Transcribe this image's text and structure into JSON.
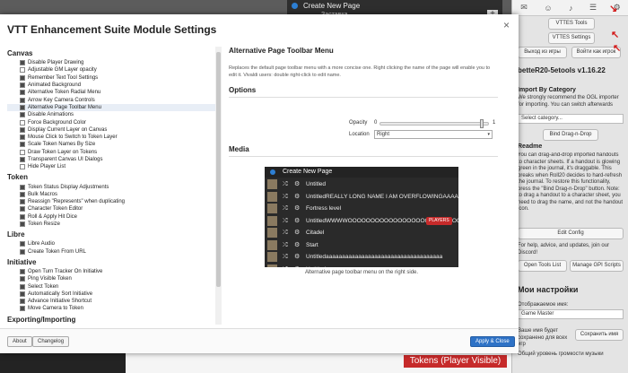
{
  "app": {
    "page_toolbar": {
      "header": "Create New Page",
      "sub": "Заставка",
      "add": "+"
    },
    "sidebar": {
      "tool_buttons": [
        "VTTES Tools",
        "VTTES Settings"
      ],
      "exit_label": "Выход из игры",
      "join_label": "Войти как игрок",
      "version": "betteR20-5etools v1.16.22",
      "import_title": "Import By Category",
      "import_desc": "We strongly recommend the OGL importer for importing. You can switch afterwards",
      "select_placeholder": "Select category...",
      "bind_label": "Bind Drag-n-Drop",
      "readme_title": "Readme",
      "readme_text": "You can drag-and-drop imported handouts to character sheets. If a handout is glowing green in the journal, it's draggable. This breaks when Roll20 decides to hard-refresh the journal. To restore this functionality, press the \"Bind Drag-n-Drop\" button. Note: to drag a handout to a character sheet, you need to drag the name, and not the handout icon.",
      "edit_config": "Edit Config",
      "help_text": "For help, advice, and updates, join our Discord!",
      "open_tools": "Open Tools List",
      "gpi_scripts": "Manage GPI Scripts",
      "my_settings": "Мои настройки",
      "display_name_label": "Отображаемое имя:",
      "display_name_value": "Game Master",
      "remember_note": "Ваше имя будет сохранено для всех игр",
      "save_name": "Сохранить имя",
      "volume_label": "Общий уровень громкости музыки"
    },
    "tokens_badge": "Tokens (Player Visible)"
  },
  "modal": {
    "title": "VTT Enhancement Suite Module Settings",
    "close": "×",
    "categories": [
      {
        "name": "Canvas",
        "items": [
          {
            "label": "Disable Player Drawing",
            "checked": true
          },
          {
            "label": "Adjustable GM Layer opacity",
            "checked": false
          },
          {
            "label": "Remember Text Tool Settings",
            "checked": true
          },
          {
            "label": "Animated Background",
            "checked": true
          },
          {
            "label": "Alternative Token Radial Menu",
            "checked": true
          },
          {
            "label": "Arrow Key Camera Controls",
            "checked": true
          },
          {
            "label": "Alternative Page Toolbar Menu",
            "checked": true
          },
          {
            "label": "Disable Animations",
            "checked": true
          },
          {
            "label": "Force Background Color",
            "checked": false
          },
          {
            "label": "Display Current Layer on Canvas",
            "checked": true
          },
          {
            "label": "Mouse Click to Switch to Token Layer",
            "checked": true
          },
          {
            "label": "Scale Token Names By Size",
            "checked": true
          },
          {
            "label": "Draw Token Layer on Tokens",
            "checked": false
          },
          {
            "label": "Transparent Canvas UI Dialogs",
            "checked": true
          },
          {
            "label": "Hide Player List",
            "checked": false
          }
        ]
      },
      {
        "name": "Token",
        "items": [
          {
            "label": "Token Status Display Adjustments",
            "checked": true
          },
          {
            "label": "Bulk Macros",
            "checked": true
          },
          {
            "label": "Reassign \"Represents\" when duplicating",
            "checked": true
          },
          {
            "label": "Character Token Editor",
            "checked": true
          },
          {
            "label": "Roll & Apply Hit Dice",
            "checked": true
          },
          {
            "label": "Token Resize",
            "checked": true
          }
        ]
      },
      {
        "name": "Libre",
        "items": [
          {
            "label": "Libre Audio",
            "checked": true
          },
          {
            "label": "Create Token From URL",
            "checked": true
          }
        ]
      },
      {
        "name": "Initiative",
        "items": [
          {
            "label": "Open Turn Tracker On Initiative",
            "checked": true
          },
          {
            "label": "Ping Visible Token",
            "checked": true
          },
          {
            "label": "Select Token",
            "checked": true
          },
          {
            "label": "Automatically Sort Initiative",
            "checked": true
          },
          {
            "label": "Advance Initiative Shortcut",
            "checked": true
          },
          {
            "label": "Move Camera to Token",
            "checked": true
          }
        ]
      },
      {
        "name": "Exporting/Importing",
        "items": []
      }
    ],
    "detail": {
      "title": "Alternative Page Toolbar Menu",
      "description": "Replaces the default page toolbar menu with a more concise one. Right clicking the name of the page will enable you to edit it. Vivaldi users: double right-click to edit name.",
      "options_heading": "Options",
      "opacity_label": "Opacity",
      "opacity_min": "0",
      "opacity_max": "1",
      "opacity_value": 0.95,
      "location_label": "Location",
      "location_value": "Right",
      "media_heading": "Media",
      "preview": {
        "header": "Create New Page",
        "pages": [
          "Untitled",
          "UntitledREALLY LONG NAME I AM OVERFLOWINGAAAAAA",
          "Fortress level",
          "UntitledWWWWOOOOOOOOOOOOOOOOOOOOOOOOO",
          "Citadel",
          "Start",
          "Untitledaaaaaaaaaaaaaaaaaaaaaaaaaaaaaaaaaaaa",
          "Untitled"
        ],
        "players_badge": "PLAYERS"
      },
      "caption": "Alternative page toolbar menu on the right side."
    },
    "footer": {
      "about": "About",
      "changelog": "Changelog",
      "apply": "Apply & Close"
    }
  },
  "colors": {
    "accent": "#2e72c6",
    "players": "#c62a2a",
    "preview_bg": "#2a2a2a"
  }
}
